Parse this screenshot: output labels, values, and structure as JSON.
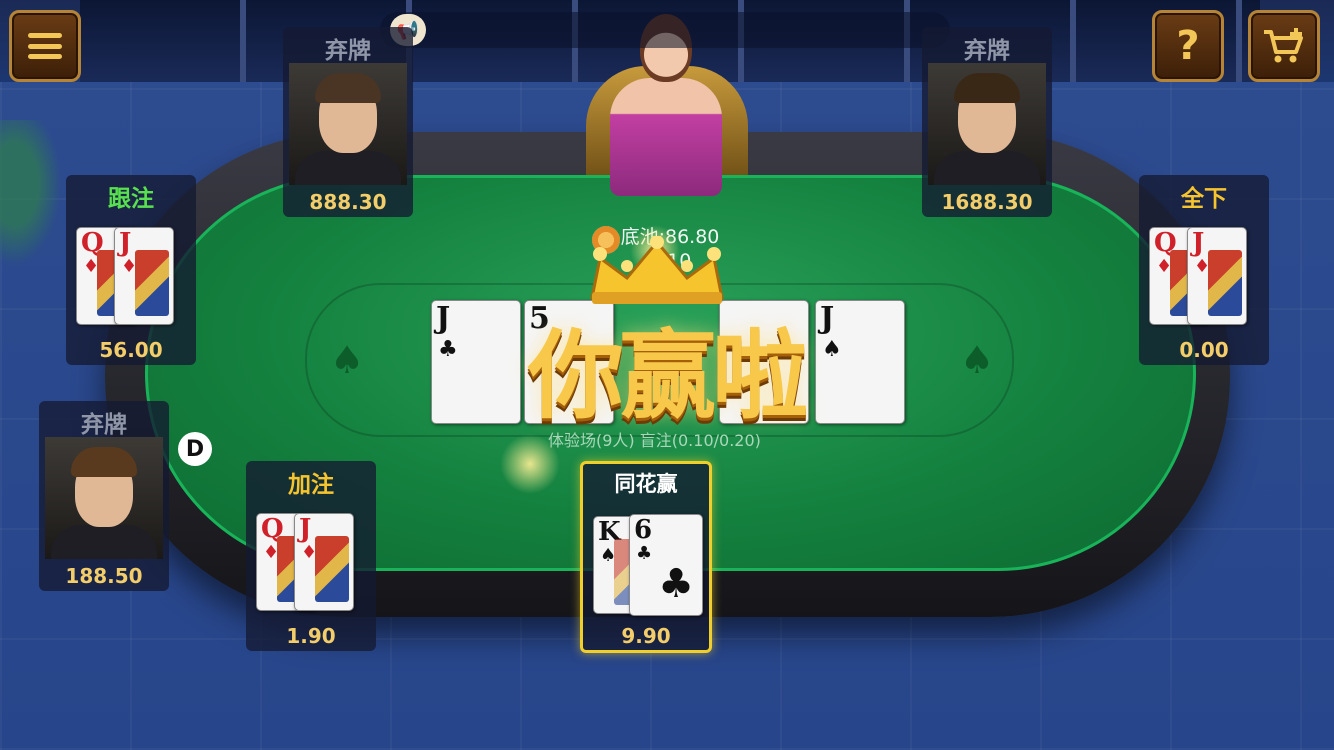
{
  "topbar": {
    "menu_icon": "hamburger-menu-icon",
    "help_label": "?",
    "cart_icon": "shopping-cart-plus-icon",
    "notice_icon": "megaphone-icon"
  },
  "pot": {
    "label": "底池:86.80",
    "sub": "6/10"
  },
  "room_info": "体验场(9人) 盲注(0.10/0.20)",
  "win_banner": "你赢啦",
  "dealer_marker": "D",
  "community_cards": [
    {
      "rank": "J",
      "suit": "♣",
      "color": "#111111"
    },
    {
      "rank": "5",
      "suit": "",
      "color": "#111111"
    },
    {
      "rank": "",
      "suit": "",
      "color": "#111111"
    },
    {
      "rank": "J",
      "suit": "♠",
      "color": "#111111"
    }
  ],
  "seats": {
    "top_left": {
      "status": "弃牌",
      "amount": "888.30"
    },
    "top_right": {
      "status": "弃牌",
      "amount": "1688.30"
    },
    "left_upper": {
      "status": "跟注",
      "amount": "56.00",
      "cards": [
        {
          "rank": "Q",
          "suit": "♦"
        },
        {
          "rank": "J",
          "suit": "♦"
        }
      ]
    },
    "right_upper": {
      "status": "全下",
      "amount": "0.00",
      "cards": [
        {
          "rank": "Q",
          "suit": "♦"
        },
        {
          "rank": "J",
          "suit": "♦"
        }
      ]
    },
    "left_lower": {
      "status": "弃牌",
      "amount": "188.50"
    },
    "bottom_left": {
      "status": "加注",
      "amount": "1.90",
      "cards": [
        {
          "rank": "Q",
          "suit": "♦"
        },
        {
          "rank": "J",
          "suit": "♦"
        }
      ]
    },
    "hero": {
      "status": "同花赢",
      "amount": "9.90",
      "cards": [
        {
          "rank": "K",
          "suit": "♠"
        },
        {
          "rank": "6",
          "suit": "♣"
        }
      ]
    }
  },
  "colors": {
    "felt": "#14813f",
    "gold": "#f6c42d",
    "call_green": "#58e04e",
    "fold_grey": "#8f96a8",
    "highlight": "#f1cf2a"
  }
}
